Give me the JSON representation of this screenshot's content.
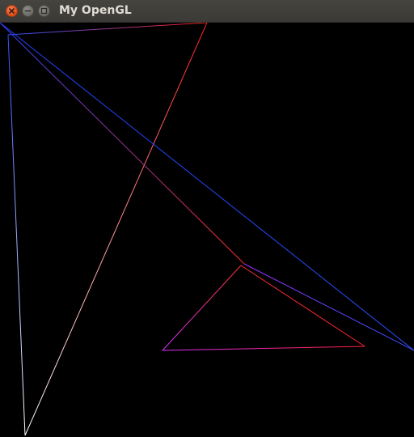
{
  "window": {
    "title": "My OpenGL",
    "controls": {
      "close_icon": "close-icon",
      "minimize_icon": "minimize-icon",
      "maximize_icon": "maximize-icon"
    }
  },
  "colors": {
    "titlebar": "#3b3a36",
    "title_text": "#dfdbd2",
    "close_button": "#df4b16",
    "background": "#000000",
    "white": "#ffffff",
    "red": "#ff2020",
    "blue": "#2040ff",
    "magenta": "#ff30ff"
  },
  "scene": {
    "primitive": "line-loop",
    "triangle_count": 3
  }
}
